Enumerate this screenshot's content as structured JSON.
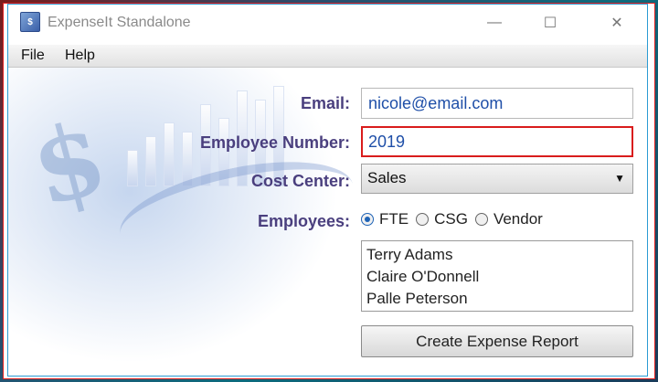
{
  "window": {
    "title": "ExpenseIt Standalone",
    "icon": "app-icon",
    "controls": {
      "minimize_icon": "minimize-icon",
      "maximize_icon": "maximize-icon",
      "close_icon": "close-icon",
      "minimize_glyph": "—",
      "maximize_glyph": "☐",
      "close_glyph": "✕"
    }
  },
  "menu": {
    "items": [
      {
        "label": "File"
      },
      {
        "label": "Help"
      }
    ]
  },
  "form": {
    "email_label": "Email:",
    "email_value": "nicole@email.com",
    "employee_number_label": "Employee Number:",
    "employee_number_value": "2019",
    "cost_center_label": "Cost Center:",
    "cost_center_value": "Sales",
    "employees_label": "Employees:",
    "employee_types": [
      {
        "label": "FTE",
        "checked": true
      },
      {
        "label": "CSG",
        "checked": false
      },
      {
        "label": "Vendor",
        "checked": false
      }
    ],
    "employees_list": [
      "Terry Adams",
      "Claire O'Donnell",
      "Palle Peterson"
    ],
    "create_button_label": "Create Expense Report"
  },
  "colors": {
    "label_color": "#4a3f7e",
    "value_color": "#1f4fa8",
    "focus_border": "#d91c1c"
  }
}
